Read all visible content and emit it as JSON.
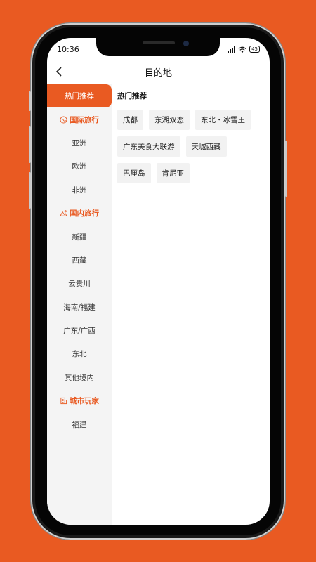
{
  "status_bar": {
    "time": "10:36",
    "battery": "45"
  },
  "header": {
    "title": "目的地"
  },
  "sidebar": {
    "items": [
      {
        "label": "热门推荐",
        "type": "active"
      },
      {
        "label": "国际旅行",
        "type": "category",
        "icon": "globe-icon"
      },
      {
        "label": "亚洲",
        "type": "item"
      },
      {
        "label": "欧洲",
        "type": "item"
      },
      {
        "label": "非洲",
        "type": "item"
      },
      {
        "label": "国内旅行",
        "type": "category",
        "icon": "mountain-icon"
      },
      {
        "label": "新疆",
        "type": "item"
      },
      {
        "label": "西藏",
        "type": "item"
      },
      {
        "label": "云贵川",
        "type": "item"
      },
      {
        "label": "海南/福建",
        "type": "item"
      },
      {
        "label": "广东/广西",
        "type": "item"
      },
      {
        "label": "东北",
        "type": "item"
      },
      {
        "label": "其他境内",
        "type": "item"
      },
      {
        "label": "城市玩家",
        "type": "category",
        "icon": "building-icon"
      },
      {
        "label": "福建",
        "type": "item"
      }
    ]
  },
  "content": {
    "section_title": "热门推荐",
    "tags": [
      "成都",
      "东湖双恋",
      "东北・冰雪王",
      "广东美食大联游",
      "天城西藏",
      "巴厘岛",
      "肯尼亚"
    ]
  },
  "colors": {
    "accent": "#e95a22",
    "sidebar_bg": "#f4f4f4",
    "tag_bg": "#f2f2f2"
  }
}
